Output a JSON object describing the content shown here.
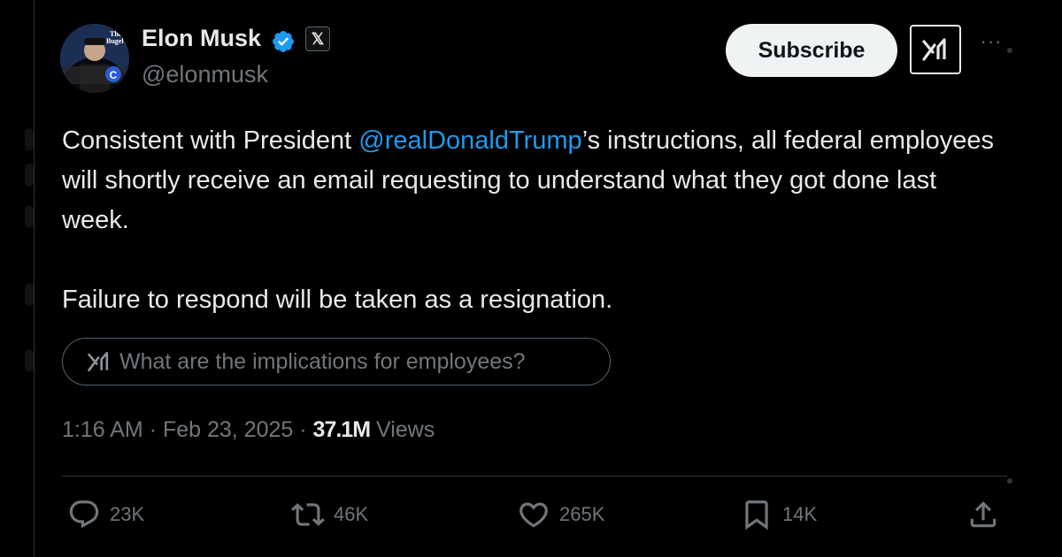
{
  "author": {
    "name": "Elon Musk",
    "handle": "@elonmusk",
    "avatar_text": "The Bugel"
  },
  "header": {
    "subscribe_label": "Subscribe",
    "more_label": "···"
  },
  "tweet": {
    "line1_before": "Consistent with President ",
    "mention": "@realDonaldTrump",
    "line1_after": "’s instructions, all federal employees will shortly receive an email requesting to understand what they got done last week.",
    "paragraph2": "Failure to respond will be taken as a resignation."
  },
  "grok_prompt": "What are the implications for employees?",
  "meta": {
    "time": "1:16 AM",
    "date": "Feb 23, 2025",
    "separator": "·",
    "views_count": "37.1M",
    "views_label": "Views"
  },
  "actions": {
    "replies": "23K",
    "reposts": "46K",
    "likes": "265K",
    "bookmarks": "14K"
  },
  "colors": {
    "background": "#000000",
    "text": "#e7e9ea",
    "secondary": "#71767b",
    "mention": "#1d9bf0",
    "verified": "#1d9bf0",
    "divider": "#2f3336"
  },
  "icons": [
    "verified-badge-icon",
    "x-logo-icon",
    "grok-icon",
    "more-icon",
    "reply-icon",
    "repost-icon",
    "like-icon",
    "bookmark-icon",
    "share-icon"
  ]
}
